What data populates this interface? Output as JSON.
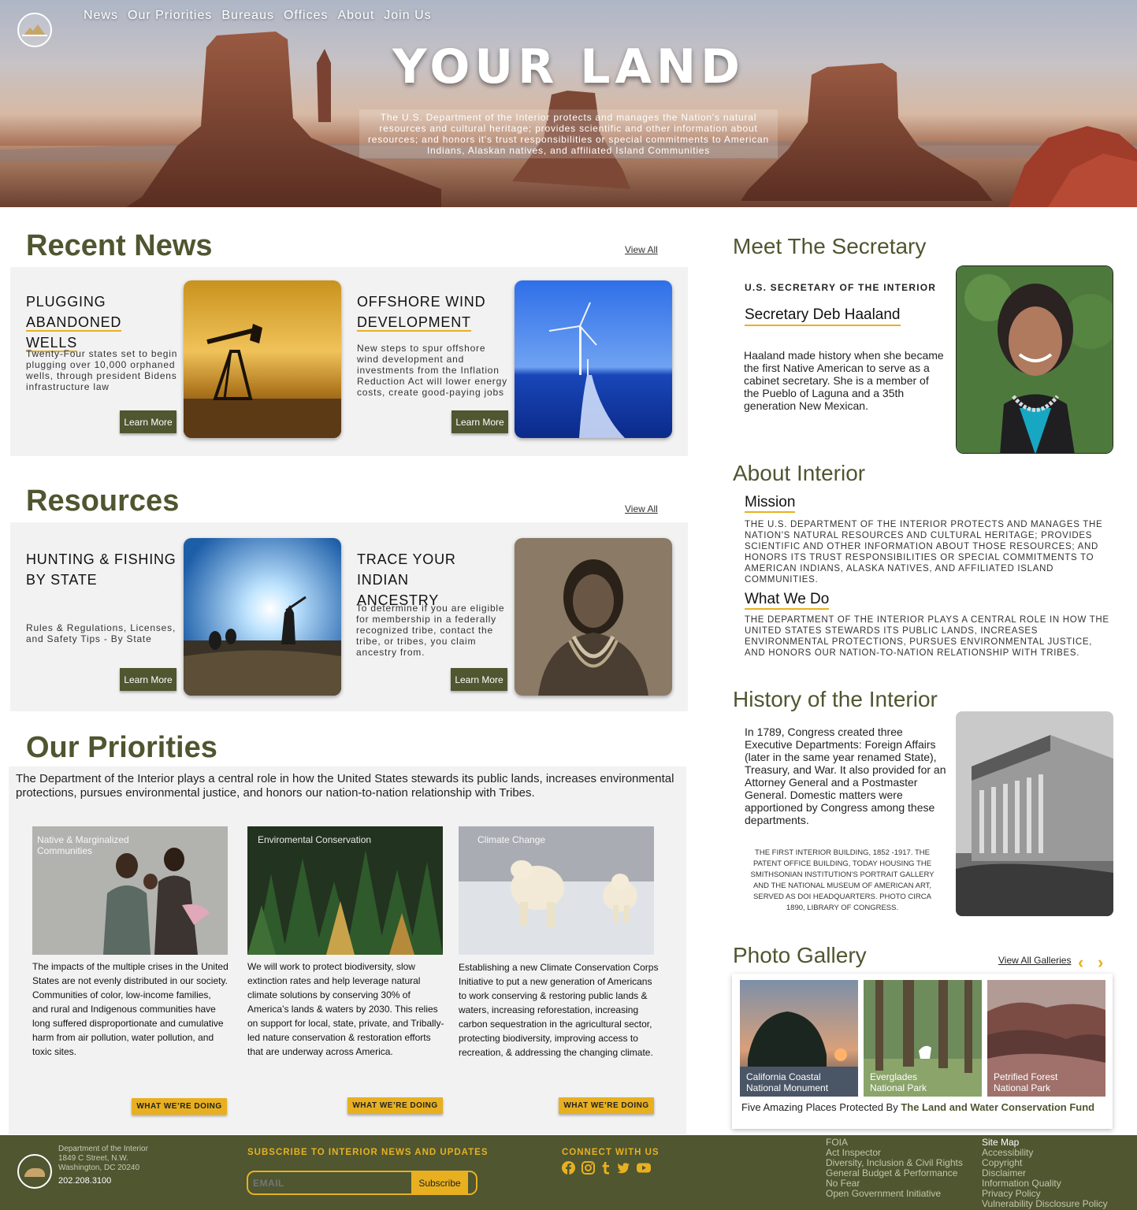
{
  "nav": {
    "items": [
      "News",
      "Our Priorities",
      "Bureaus",
      "Offices",
      "About",
      "Join Us"
    ]
  },
  "hero": {
    "title": "YOUR LAND",
    "description": "The U.S. Department of the Interior protects and manages the Nation's natural resources and cultural heritage; provides scientific and other information about resources; and honors it's trust responsibilities or special commitments to American Indians, Alaskan natives, and affiliated Island Communities"
  },
  "news": {
    "title": "Recent News",
    "view_all": "View All",
    "cards": [
      {
        "title_line1": "PLUGGING",
        "title_line2": "ABANDONED WELLS",
        "text": "Twenty-Four states set to begin plugging over 10,000 orphaned wells, through president Bidens infrastructure law",
        "button": "Learn More"
      },
      {
        "title_line1": "OFFSHORE WIND",
        "title_line2": "DEVELOPMENT",
        "text": "New steps to spur offshore wind development and investments from the Inflation Reduction Act will lower energy costs, create good-paying jobs",
        "button": "Learn More"
      }
    ]
  },
  "resources": {
    "title": "Resources",
    "view_all": "View All",
    "cards": [
      {
        "title_line1": "HUNTING & FISHING",
        "title_line2": "BY STATE",
        "text": "Rules & Regulations, Licenses, and Safety Tips - By State",
        "button": "Learn More"
      },
      {
        "title_line1": "TRACE YOUR INDIAN",
        "title_line2": "ANCESTRY",
        "text": "To determine if you are eligible for membership in a federally recognized tribe, contact the tribe, or tribes, you claim ancestry from.",
        "button": "Learn More"
      }
    ]
  },
  "priorities": {
    "title": "Our Priorities",
    "intro": "The Department of the Interior plays a central role in how the United States stewards its public lands, increases environmental protections, pursues environmental justice, and honors our nation-to-nation relationship with Tribes.",
    "items": [
      {
        "caption": "Native & Marginalized Communities",
        "text": "The impacts of the multiple crises in the United States are not evenly distributed in our society. Communities of color, low-income families, and rural and Indigenous communities have long suffered disproportionate and cumulative harm from air pollution, water pollution, and toxic sites.",
        "button": "WHAT WE’RE DOING"
      },
      {
        "caption": "Enviromental Conservation",
        "text": "We will work to protect biodiversity, slow extinction rates and help leverage natural climate solutions by conserving 30% of America’s lands & waters by 2030. This relies on support for local, state, private, and Tribally-led nature conservation & restoration efforts that are underway across America.",
        "button": "WHAT WE’RE DOING"
      },
      {
        "caption": "Climate Change",
        "text": " Establishing a new Climate Conservation Corps Initiative to put a new generation of Americans to work conserving & restoring public lands & waters, increasing reforestation, increasing carbon sequestration in the agricultural sector, protecting biodiversity, improving access to recreation, & addressing the changing climate.",
        "button": "WHAT WE’RE DOING"
      }
    ]
  },
  "secretary": {
    "section_title": "Meet The Secretary",
    "role": "U.S. SECRETARY OF THE INTERIOR",
    "name": "Secretary Deb Haaland",
    "bio": "Haaland made history when she became the first Native American to serve as a cabinet secretary. She is a member of the Pueblo of Laguna and a 35th generation New Mexican."
  },
  "about": {
    "section_title": "About Interior",
    "mission_title": "Mission",
    "mission_text": "THE U.S. DEPARTMENT OF THE INTERIOR PROTECTS AND MANAGES THE NATION'S NATURAL RESOURCES AND CULTURAL HERITAGE; PROVIDES SCIENTIFIC AND OTHER INFORMATION ABOUT THOSE RESOURCES; AND HONORS ITS TRUST RESPONSIBILITIES OR SPECIAL COMMITMENTS TO AMERICAN INDIANS, ALASKA NATIVES, AND AFFILIATED ISLAND COMMUNITIES.",
    "whatwedo_title": "What We Do",
    "whatwedo_text": "THE DEPARTMENT OF THE INTERIOR PLAYS A CENTRAL ROLE IN HOW THE UNITED STATES STEWARDS ITS PUBLIC LANDS, INCREASES ENVIRONMENTAL PROTECTIONS, PURSUES ENVIRONMENTAL JUSTICE, AND HONORS OUR NATION-TO-NATION RELATIONSHIP WITH TRIBES."
  },
  "history": {
    "section_title": "History of the Interior",
    "text": "In 1789, Congress created three Executive Departments: Foreign Affairs (later in the same year renamed State), Treasury, and War. It also provided for an Attorney General and a Postmaster General. Domestic matters were apportioned by Congress among these departments.",
    "caption": "THE FIRST INTERIOR BUILDING, 1852 -1917. THE PATENT OFFICE BUILDING, TODAY HOUSING THE SMITHSONIAN INSTITUTION'S PORTRAIT GALLERY AND THE NATIONAL MUSEUM OF AMERICAN ART, SERVED AS DOI HEADQUARTERS. PHOTO CIRCA 1890, LIBRARY OF CONGRESS."
  },
  "gallery": {
    "section_title": "Photo Gallery",
    "view_all": "View All Galleries",
    "items": [
      {
        "caption": "California Coastal National Monument"
      },
      {
        "caption": "Everglades National Park"
      },
      {
        "caption": "Petrified Forest National Park"
      }
    ],
    "footer_prefix": "Five Amazing Places Protected By ",
    "footer_bold": "The Land and Water Conservation Fund"
  },
  "footer": {
    "org": "Department of the Interior",
    "address1": "1849 C Street, N.W.",
    "address2": "Washington, DC 20240",
    "phone": "202.208.3100",
    "subscribe_title": "SUBSCRIBE TO INTERIOR NEWS AND UPDATES",
    "email_placeholder": "EMAIL",
    "subscribe_button": "Subscribe",
    "connect_title": "CONNECT WITH US",
    "social_icons": [
      "facebook-icon",
      "instagram-icon",
      "tumblr-icon",
      "twitter-icon",
      "youtube-icon"
    ],
    "links_col1": [
      "FOIA",
      "Act Inspector",
      "Diversity, Inclusion & Civil Rights",
      "General Budget & Performance",
      "No Fear",
      "Open Government Initiative"
    ],
    "links_col2_title": "Site Map",
    "links_col2": [
      "Accessibility",
      "Copyright",
      "Disclaimer",
      "Information Quality",
      "Privacy Policy",
      "Vulnerability Disclosure Policy"
    ]
  },
  "colors": {
    "olive": "#4f5630",
    "gold": "#e8b020",
    "panel": "#f2f2f2"
  }
}
